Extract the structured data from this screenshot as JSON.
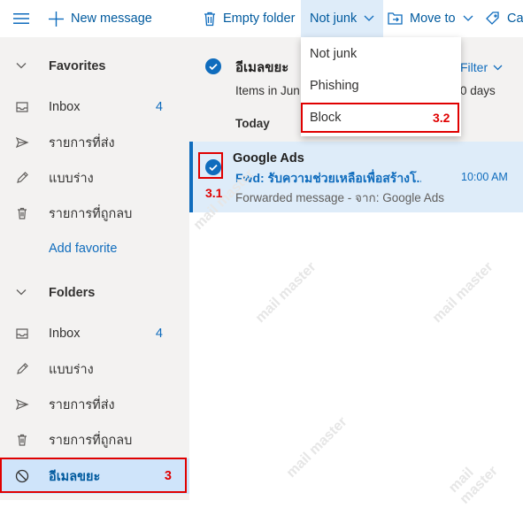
{
  "toolbar": {
    "new_message": "New message",
    "empty_folder": "Empty folder",
    "not_junk": "Not junk",
    "move_to": "Move to",
    "categorize_partial": "Ca"
  },
  "nav": {
    "favorites_label": "Favorites",
    "favorites": [
      {
        "label": "Inbox",
        "count": "4",
        "icon": "inbox-icon"
      },
      {
        "label": "รายการที่ส่ง",
        "count": "",
        "icon": "send-icon"
      },
      {
        "label": "แบบร่าง",
        "count": "",
        "icon": "pencil-icon"
      },
      {
        "label": "รายการที่ถูกลบ",
        "count": "",
        "icon": "trash-icon"
      }
    ],
    "add_favorite": "Add favorite",
    "folders_label": "Folders",
    "folders": [
      {
        "label": "Inbox",
        "count": "4",
        "icon": "inbox-icon"
      },
      {
        "label": "แบบร่าง",
        "count": "",
        "icon": "pencil-icon"
      },
      {
        "label": "รายการที่ส่ง",
        "count": "",
        "icon": "send-icon"
      },
      {
        "label": "รายการที่ถูกลบ",
        "count": "",
        "icon": "trash-icon"
      }
    ],
    "junk": {
      "label": "อีเมลขยะ",
      "count": "3",
      "icon": "block-icon"
    }
  },
  "list": {
    "folder_title": "อีเมลขยะ",
    "filter_label": "Filter",
    "info_start": "Items in Jun",
    "info_end": "0 days",
    "today_label": "Today"
  },
  "message": {
    "sender": "Google Ads",
    "subject": "Fwd: รับความช่วยเหลือเพื่อสร้างโ...",
    "time": "10:00 AM",
    "preview": "Forwarded message - จาก: Google Ads"
  },
  "dropdown": {
    "items": [
      "Not junk",
      "Phishing",
      "Block"
    ]
  },
  "annotations": {
    "step_3": "3",
    "step_3_1": "3.1",
    "step_3_2": "3.2"
  },
  "watermark": "mail master",
  "colors": {
    "accent": "#0f6cbd",
    "annotation_red": "#e00000",
    "selected_bg": "#deecf9"
  }
}
